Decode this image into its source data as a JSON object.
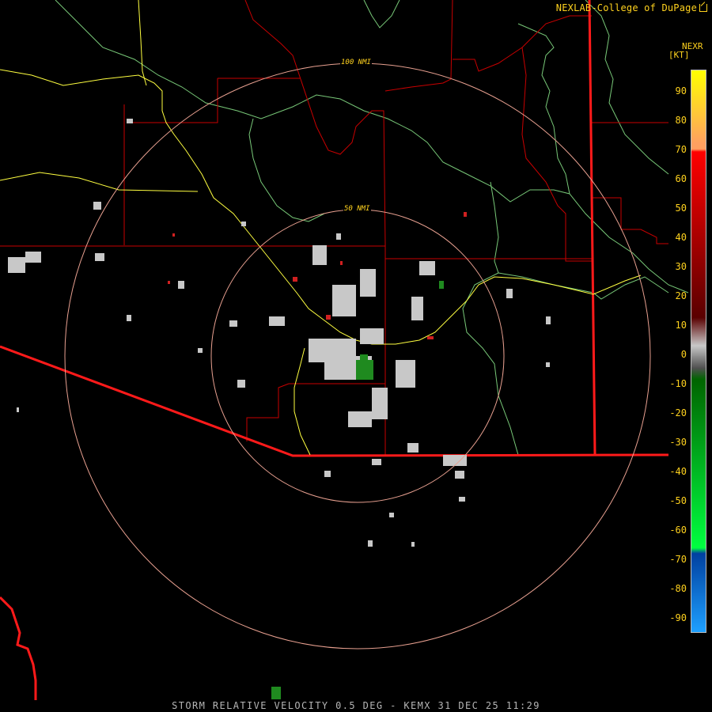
{
  "header": {
    "credit": "NEXLAB-College of DuPage",
    "credit_icon": "external-link-icon"
  },
  "legend": {
    "product": "NEXR",
    "units": "[KT]",
    "ticks": [
      "90",
      "80",
      "70",
      "60",
      "50",
      "40",
      "30",
      "20",
      "10",
      "0",
      "-10",
      "-20",
      "-30",
      "-40",
      "-50",
      "-60",
      "-70",
      "-80",
      "-90"
    ],
    "colors": {
      "top_yellow": "#ffff00",
      "orange": "#ffa060",
      "red": "#ff0000",
      "dark_red": "#5a0000",
      "gray": "#c8c8c8",
      "dark_green": "#006400",
      "green": "#00ff40",
      "dark_blue": "#0040a0",
      "light_blue": "#1ea0ff"
    }
  },
  "range_rings": {
    "outer_label": "100 NMI",
    "inner_label": "50 NMI",
    "ring_color": "#e8a090"
  },
  "map_colors": {
    "county_lines": "#c80000",
    "state_border": "#ff1a1a",
    "highways": "#ffff40",
    "rivers": "#78c878",
    "echo_gray": "#c8c8c8",
    "echo_green": "#1f8a1f",
    "echo_red": "#d02020"
  },
  "caption": "STORM RELATIVE VELOCITY 0.5 DEG - KEMX 31 DEC 25 11:29"
}
